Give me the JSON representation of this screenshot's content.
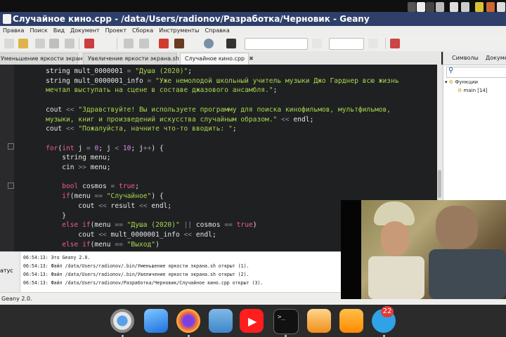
{
  "window": {
    "title": "Случайное кино.cpp - /data/Users/radionov/Разработка/Черновик - Geany"
  },
  "menu": [
    "Правка",
    "Поиск",
    "Вид",
    "Документ",
    "Проект",
    "Сборка",
    "Инструменты",
    "Справка"
  ],
  "tabs": [
    {
      "label": "Уменьшение яркости экрана.sh"
    },
    {
      "label": "Увеличение яркости экрана.sh"
    },
    {
      "label": "Случайное кино.cpp",
      "active": true
    }
  ],
  "side_panel": {
    "tabs": [
      "Символы",
      "Докумен"
    ],
    "tree": {
      "group": "Функции",
      "item": "main [14]"
    }
  },
  "code_lines": [
    [
      {
        "t": "    string mult_0000001 ",
        "c": ""
      },
      {
        "t": "=",
        "c": "op"
      },
      {
        "t": " ",
        "c": ""
      },
      {
        "t": "\"Душа (2020)\"",
        "c": "str"
      },
      {
        "t": ";",
        "c": ""
      }
    ],
    [
      {
        "t": "    string mult_0000001_info ",
        "c": ""
      },
      {
        "t": "=",
        "c": "op"
      },
      {
        "t": " ",
        "c": ""
      },
      {
        "t": "\"Уже немолодой школьный учитель музыки Джо Гарднер всю жизнь",
        "c": "str"
      }
    ],
    [
      {
        "t": "    мечтал выступать на сцене в составе джазового ансамбля.\"",
        "c": "str"
      },
      {
        "t": ";",
        "c": ""
      }
    ],
    [
      {
        "t": "",
        "c": ""
      }
    ],
    [
      {
        "t": "    cout ",
        "c": ""
      },
      {
        "t": "<<",
        "c": "op"
      },
      {
        "t": " ",
        "c": ""
      },
      {
        "t": "\"Здравствуйте! Вы используете программу для поиска кинофильмов, мультфильмов,",
        "c": "str"
      }
    ],
    [
      {
        "t": "    музыки, книг и произведений искусства случайным образом.\"",
        "c": "str"
      },
      {
        "t": " ",
        "c": ""
      },
      {
        "t": "<<",
        "c": "op"
      },
      {
        "t": " endl;",
        "c": ""
      }
    ],
    [
      {
        "t": "    cout ",
        "c": ""
      },
      {
        "t": "<<",
        "c": "op"
      },
      {
        "t": " ",
        "c": ""
      },
      {
        "t": "\"Пожалуйста, начните что-то вводить: \"",
        "c": "str"
      },
      {
        "t": ";",
        "c": ""
      }
    ],
    [
      {
        "t": "",
        "c": ""
      }
    ],
    [
      {
        "t": "    ",
        "c": ""
      },
      {
        "t": "for",
        "c": "kw"
      },
      {
        "t": "(",
        "c": ""
      },
      {
        "t": "int",
        "c": "kw"
      },
      {
        "t": " j ",
        "c": ""
      },
      {
        "t": "=",
        "c": "op"
      },
      {
        "t": " ",
        "c": ""
      },
      {
        "t": "0",
        "c": "num"
      },
      {
        "t": "; j ",
        "c": ""
      },
      {
        "t": "<",
        "c": "op"
      },
      {
        "t": " ",
        "c": ""
      },
      {
        "t": "10",
        "c": "num"
      },
      {
        "t": "; j",
        "c": ""
      },
      {
        "t": "++",
        "c": "op"
      },
      {
        "t": ") {",
        "c": ""
      }
    ],
    [
      {
        "t": "        string menu;",
        "c": ""
      }
    ],
    [
      {
        "t": "        cin ",
        "c": ""
      },
      {
        "t": ">>",
        "c": "op"
      },
      {
        "t": " menu;",
        "c": ""
      }
    ],
    [
      {
        "t": "",
        "c": ""
      }
    ],
    [
      {
        "t": "        ",
        "c": ""
      },
      {
        "t": "bool",
        "c": "kw"
      },
      {
        "t": " cosmos ",
        "c": ""
      },
      {
        "t": "=",
        "c": "op"
      },
      {
        "t": " ",
        "c": ""
      },
      {
        "t": "true",
        "c": "kw"
      },
      {
        "t": ";",
        "c": ""
      }
    ],
    [
      {
        "t": "        ",
        "c": ""
      },
      {
        "t": "if",
        "c": "kw"
      },
      {
        "t": "(menu ",
        "c": ""
      },
      {
        "t": "==",
        "c": "op"
      },
      {
        "t": " ",
        "c": ""
      },
      {
        "t": "\"Случайное\"",
        "c": "str"
      },
      {
        "t": ") {",
        "c": ""
      }
    ],
    [
      {
        "t": "            cout ",
        "c": ""
      },
      {
        "t": "<<",
        "c": "op"
      },
      {
        "t": " result ",
        "c": ""
      },
      {
        "t": "<<",
        "c": "op"
      },
      {
        "t": " endl;",
        "c": ""
      }
    ],
    [
      {
        "t": "        }",
        "c": ""
      }
    ],
    [
      {
        "t": "        ",
        "c": ""
      },
      {
        "t": "else if",
        "c": "kw"
      },
      {
        "t": "(menu ",
        "c": ""
      },
      {
        "t": "==",
        "c": "op"
      },
      {
        "t": " ",
        "c": ""
      },
      {
        "t": "\"Душа (2020)\"",
        "c": "str"
      },
      {
        "t": " ",
        "c": ""
      },
      {
        "t": "||",
        "c": "op"
      },
      {
        "t": " cosmos ",
        "c": ""
      },
      {
        "t": "==",
        "c": "op"
      },
      {
        "t": " ",
        "c": ""
      },
      {
        "t": "true",
        "c": "kw"
      },
      {
        "t": ")",
        "c": ""
      }
    ],
    [
      {
        "t": "            cout ",
        "c": ""
      },
      {
        "t": "<<",
        "c": "op"
      },
      {
        "t": " mult_0000001_info ",
        "c": ""
      },
      {
        "t": "<<",
        "c": "op"
      },
      {
        "t": " endl;",
        "c": ""
      }
    ],
    [
      {
        "t": "        ",
        "c": ""
      },
      {
        "t": "else if",
        "c": "kw"
      },
      {
        "t": "(menu ",
        "c": ""
      },
      {
        "t": "==",
        "c": "op"
      },
      {
        "t": " ",
        "c": ""
      },
      {
        "t": "\"Выход\"",
        "c": "str"
      },
      {
        "t": ")",
        "c": ""
      }
    ]
  ],
  "messages": {
    "tab_label": "атус",
    "lines": [
      "06:54:13: Это Geany 2.0.",
      "06:54:13: Файл /data/Users/radionov/.bin/Уменьшение яркости экрана.sh открыт (1).",
      "06:54:13: Файл /data/Users/radionov/.bin/Увеличение яркости экрана.sh открыт (2).",
      "06:54:13: Файл /data/Users/radionov/Разработка/Черновик/Случайное кино.cpp открыт (3)."
    ]
  },
  "status": {
    "text": "Geany 2.0."
  },
  "dock": {
    "badge": "22",
    "apps": [
      "chrome-icon",
      "xcode-icon",
      "firefox-icon",
      "files-icon",
      "youtube-icon",
      "terminal-icon",
      "textedit-icon",
      "pages-icon",
      "telegram-icon"
    ]
  },
  "colors": {
    "titlebar": "#2e3f6a",
    "editor_bg": "#1f2022",
    "string": "#a8d84f",
    "keyword": "#f25c8a",
    "number": "#d48bf0"
  }
}
